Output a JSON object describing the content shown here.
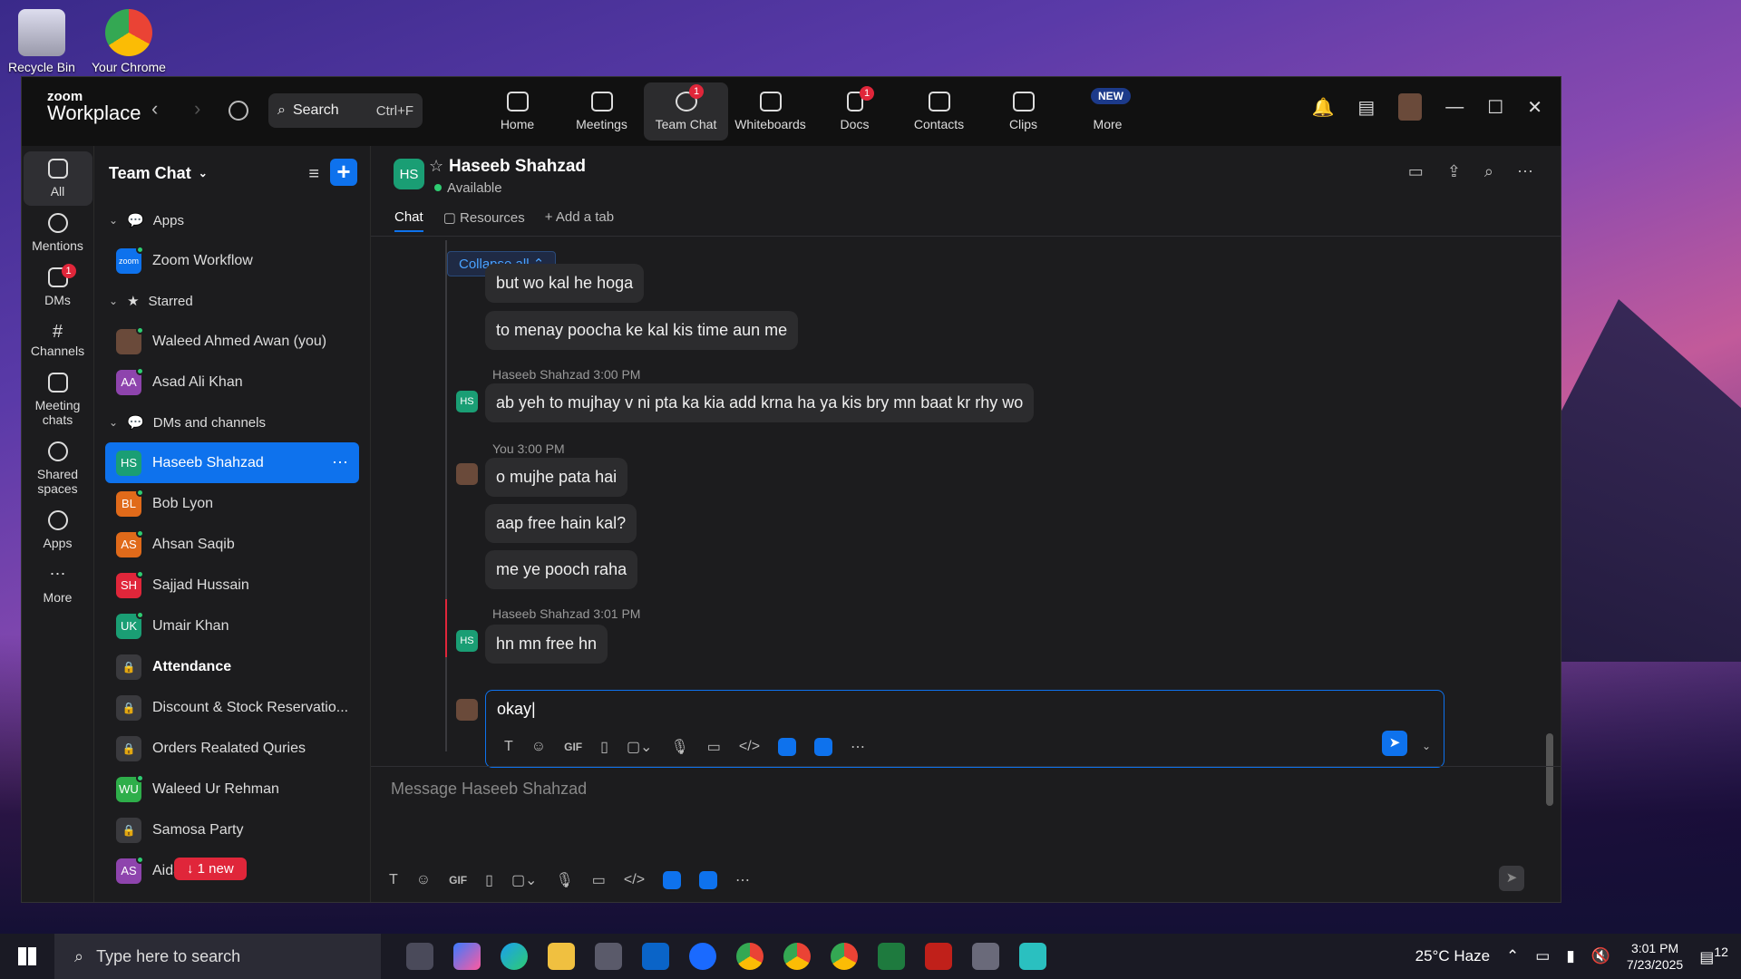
{
  "desktop": {
    "icons": [
      {
        "label": "Recycle Bin"
      },
      {
        "label": "Your Chrome"
      }
    ]
  },
  "titlebar": {
    "logo_top": "zoom",
    "logo_bottom": "Workplace",
    "search_label": "Search",
    "search_shortcut": "Ctrl+F"
  },
  "topnav": [
    {
      "label": "Home"
    },
    {
      "label": "Meetings"
    },
    {
      "label": "Team Chat",
      "badge": "1"
    },
    {
      "label": "Whiteboards"
    },
    {
      "label": "Docs",
      "badge": "1"
    },
    {
      "label": "Contacts"
    },
    {
      "label": "Clips"
    },
    {
      "label": "More",
      "new": "NEW"
    }
  ],
  "rail": [
    {
      "label": "All"
    },
    {
      "label": "Mentions"
    },
    {
      "label": "DMs",
      "badge": "1"
    },
    {
      "label": "Channels"
    },
    {
      "label": "Meeting chats"
    },
    {
      "label": "Shared spaces"
    },
    {
      "label": "Apps"
    },
    {
      "label": "More"
    }
  ],
  "sidebar": {
    "title": "Team Chat",
    "sections": {
      "apps": "Apps",
      "starred": "Starred",
      "dms": "DMs and channels"
    },
    "apps": [
      {
        "name": "Zoom Workflow",
        "initials": "zoom"
      }
    ],
    "starred": [
      {
        "name": "Waleed Ahmed Awan (you)"
      },
      {
        "name": "Asad Ali Khan",
        "initials": "AA"
      }
    ],
    "dms": [
      {
        "name": "Haseeb Shahzad",
        "initials": "HS"
      },
      {
        "name": "Bob Lyon",
        "initials": "BL"
      },
      {
        "name": "Ahsan Saqib",
        "initials": "AS"
      },
      {
        "name": "Sajjad Hussain",
        "initials": "SH"
      },
      {
        "name": "Umair Khan",
        "initials": "UK"
      },
      {
        "name": "Attendance"
      },
      {
        "name": "Discount & Stock Reservatio..."
      },
      {
        "name": "Orders Realated Quries"
      },
      {
        "name": "Waleed Ur Rehman",
        "initials": "WU"
      },
      {
        "name": "Samosa Party"
      },
      {
        "name": "Aidan",
        "initials": "AS",
        "new_label": "↓ 1 new"
      }
    ]
  },
  "chat": {
    "contact": "Haseeb Shahzad",
    "initials": "HS",
    "status": "Available",
    "tabs": [
      "Chat",
      "Resources",
      "Add a tab"
    ],
    "collapse": "Collapse all",
    "messages": [
      "but wo kal he hoga",
      "to menay poocha ke kal kis time aun me",
      "ab yeh to mujhay v ni pta ka kia add krna ha ya kis bry mn baat kr rhy wo",
      "o mujhe pata hai",
      "aap free hain kal?",
      "me ye pooch raha",
      "hn mn free hn"
    ],
    "meta": [
      "Haseeb Shahzad 3:00 PM",
      "You 3:00 PM",
      "Haseeb Shahzad 3:01 PM"
    ],
    "compose_text": "okay",
    "message_placeholder": "Message Haseeb Shahzad",
    "gif": "GIF"
  },
  "taskbar": {
    "search_placeholder": "Type here to search",
    "weather": "25°C  Haze",
    "time": "3:01 PM",
    "date": "7/23/2025",
    "notif": "12"
  }
}
